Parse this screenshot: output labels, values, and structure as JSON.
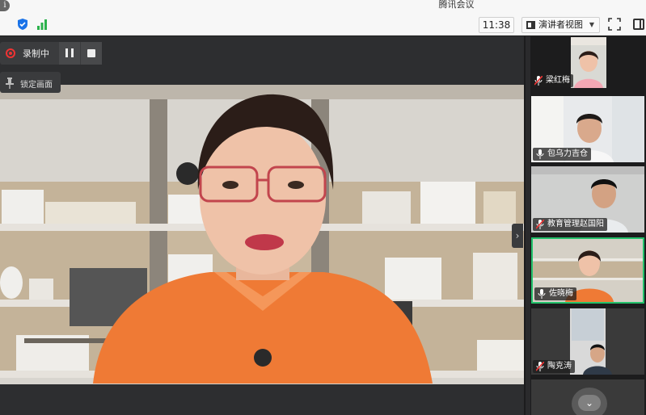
{
  "app": {
    "title": "腾讯会议"
  },
  "toolbar": {
    "time": "11:38",
    "view_label": "演讲者视图",
    "view_caret": "▼"
  },
  "recording": {
    "status_label": "录制中",
    "lock_label": "锁定画面"
  },
  "icons": {
    "info": "info-icon",
    "shield": "shield-icon",
    "signal": "signal-icon",
    "fullscreen": "fullscreen-icon",
    "sidebar_toggle": "sidebar-toggle-icon",
    "record": "record-icon",
    "pause": "pause-icon",
    "stop": "stop-icon",
    "pin": "pin-icon",
    "mic": "mic-icon",
    "mic_muted": "mic-muted-icon"
  },
  "participants": [
    {
      "name": "梁红梅",
      "mic": "muted"
    },
    {
      "name": "包乌力吉仓",
      "mic": "on"
    },
    {
      "name": "教育管理赵国阳",
      "mic": "muted"
    },
    {
      "name": "佐晓梅",
      "mic": "on",
      "active": true
    },
    {
      "name": "陶克涛",
      "mic": "muted"
    }
  ],
  "nav": {
    "next_arrow": "›",
    "scroll_down": "⌄"
  },
  "colors": {
    "accent_green": "#23c16b",
    "record_red": "#e33333",
    "shield_blue": "#1a73e8",
    "signal_green": "#2bb24c"
  }
}
